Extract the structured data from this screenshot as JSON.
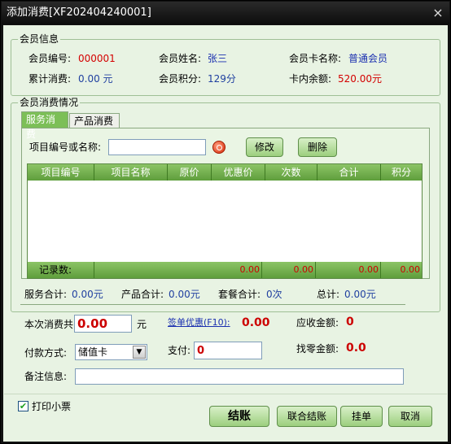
{
  "window": {
    "title": "添加消费[XF202404240001]",
    "close_glyph": "×"
  },
  "member_info": {
    "legend": "会员信息",
    "number_label": "会员编号:",
    "number_value": "000001",
    "name_label": "会员姓名:",
    "name_value": "张三",
    "card_label": "会员卡名称:",
    "card_value": "普通会员",
    "total_label": "累计消费:",
    "total_value": "0.00 元",
    "points_label": "会员积分:",
    "points_value": "129分",
    "balance_label": "卡内余额:",
    "balance_value": "520.00元"
  },
  "consumption": {
    "legend": "会员消费情况",
    "tabs": [
      {
        "label": "服务消费"
      },
      {
        "label": "产品消费"
      }
    ],
    "search_label": "项目编号或名称:",
    "search_value": "",
    "modify_label": "修改",
    "delete_label": "删除",
    "grid": {
      "columns": [
        "项目编号",
        "项目名称",
        "原价",
        "优惠价",
        "次数",
        "合计",
        "积分"
      ],
      "rows": [],
      "footer_label": "记录数:",
      "footer_values": [
        "0.00",
        "0.00",
        "0.00",
        "0.00"
      ]
    }
  },
  "summary": {
    "service_label": "服务合计:",
    "service_value": "0.00元",
    "product_label": "产品合计:",
    "product_value": "0.00元",
    "package_label": "套餐合计:",
    "package_value": "0次",
    "total_label": "总计:",
    "total_value": "0.00元"
  },
  "payment": {
    "this_label": "本次消费共",
    "this_value": "0.00",
    "this_unit": "元",
    "discount_label": "签单优惠(F10):",
    "discount_value": "0.00",
    "receivable_label": "应收金额:",
    "receivable_value": "0",
    "method_label": "付款方式:",
    "method_value": "储值卡",
    "pay_label": "支付:",
    "pay_value": "0",
    "change_label": "找零金额:",
    "change_value": "0.0",
    "remark_label": "备注信息:",
    "remark_value": ""
  },
  "footer": {
    "print_label": "打印小票",
    "print_checked": true,
    "checkout_label": "结账",
    "combined_label": "联合结账",
    "hold_label": "挂单",
    "cancel_label": "取消"
  }
}
